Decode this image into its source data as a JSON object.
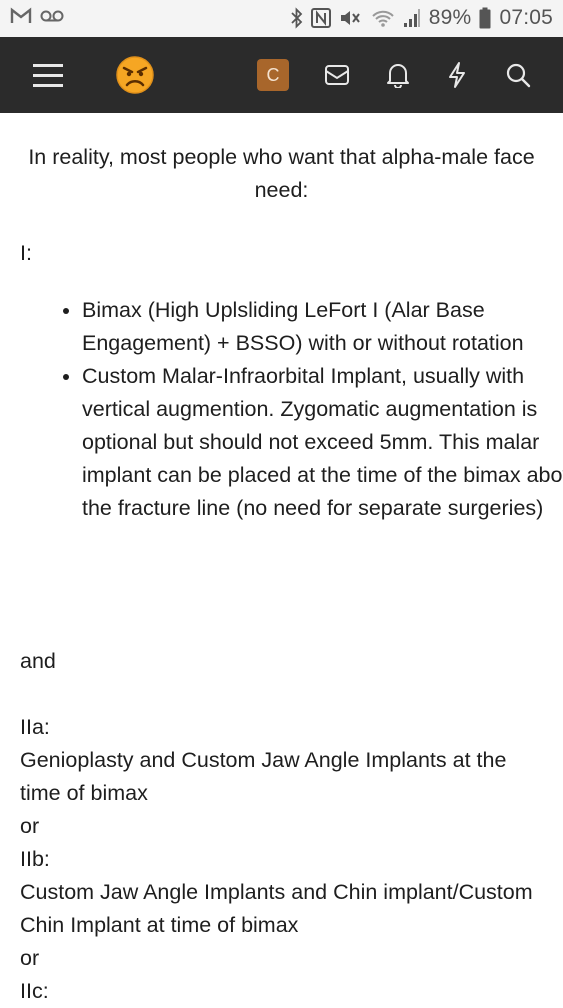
{
  "status_bar": {
    "battery": "89%",
    "time": "07:05",
    "left_icons": [
      "gmail-icon",
      "voicemail-icon"
    ],
    "right_icons": [
      "bluetooth-icon",
      "nfc-icon",
      "mute-icon",
      "wifi-icon",
      "signal-icon",
      "battery-icon"
    ]
  },
  "header": {
    "avatar_letter": "C",
    "icons": [
      "menu-icon",
      "angry-emoji-icon",
      "inbox-icon",
      "bell-icon",
      "lightning-icon",
      "search-icon"
    ]
  },
  "post": {
    "intro": "In reality, most people who want that alpha-male face need:",
    "section_1": "I:",
    "bullets": [
      "Bimax (High Uplsliding LeFort I (Alar Base Engagement) + BSSO) with or without rotation",
      "Custom Malar-Infraorbital Implant, usually with vertical augmention. Zygomatic augmentation is optional but should not exceed 5mm. This malar implant can be placed at the time of the bimax above the fracture line (no need for separate surgeries)"
    ],
    "and": "and",
    "section_2a": "IIa:",
    "text_2a": "Genioplasty and Custom Jaw Angle Implants at the time of bimax",
    "or_1": "or",
    "section_2b": "IIb:",
    "text_2b": "Custom Jaw Angle Implants and Chin implant/Custom Chin Implant at time of bimax",
    "or_2": "or",
    "section_2c": "IIc:"
  },
  "colors": {
    "appbar": "#2b2b2b",
    "avatar_bg": "#a8662b",
    "status_bar": "#f4f4f4"
  }
}
